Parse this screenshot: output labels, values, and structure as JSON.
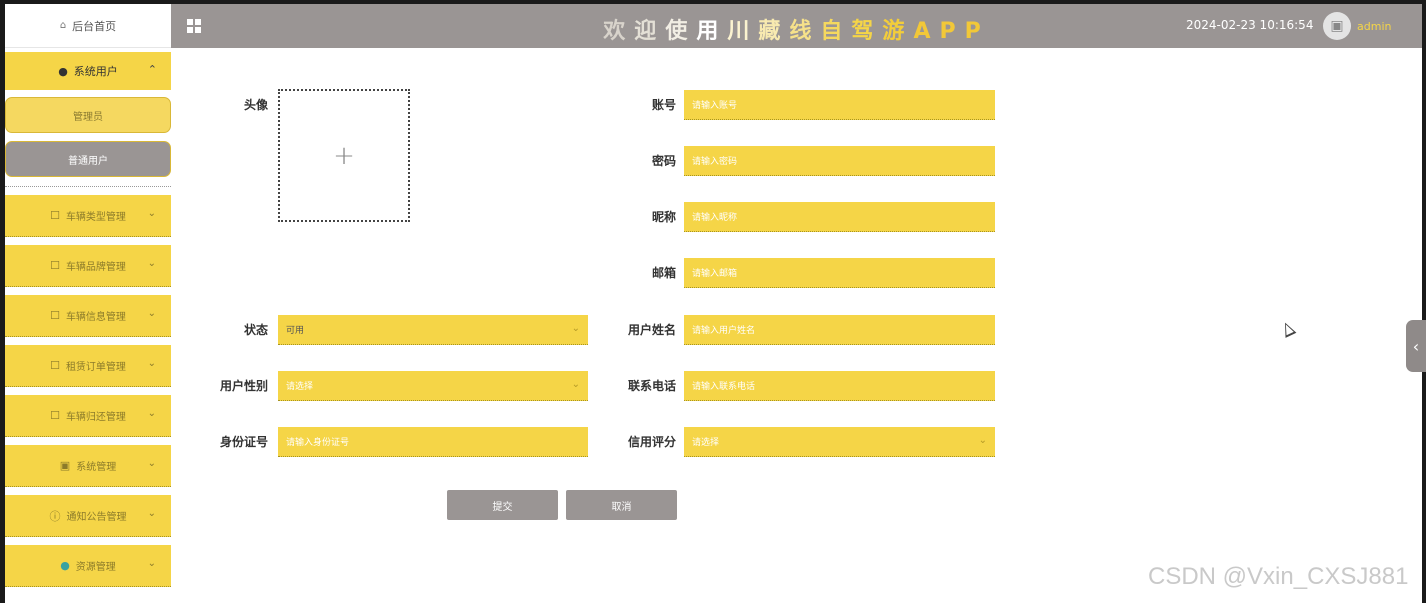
{
  "sidebar": {
    "home": {
      "label": "后台首页",
      "icon": "home-icon"
    },
    "open_menu": {
      "label": "系统用户",
      "icon": "user-icon"
    },
    "sub_items": [
      {
        "label": "管理员"
      },
      {
        "label": "普通用户"
      }
    ],
    "items": [
      {
        "label": "车辆类型管理",
        "icon": "edit-icon"
      },
      {
        "label": "车辆品牌管理",
        "icon": "edit-icon"
      },
      {
        "label": "车辆信息管理",
        "icon": "edit-icon"
      },
      {
        "label": "租赁订单管理",
        "icon": "edit-icon"
      },
      {
        "label": "车辆归还管理",
        "icon": "edit-icon"
      },
      {
        "label": "系统管理",
        "icon": "picture-icon"
      },
      {
        "label": "通知公告管理",
        "icon": "info-icon"
      },
      {
        "label": "资源管理",
        "icon": "location-icon"
      }
    ]
  },
  "header": {
    "title_chars": [
      {
        "ch": "欢",
        "color": "#d8d3cb"
      },
      {
        "ch": "迎",
        "color": "#e4e0d6"
      },
      {
        "ch": "使",
        "color": "#f2eee4"
      },
      {
        "ch": "用",
        "color": "#ffffff"
      },
      {
        "ch": "川",
        "color": "#fbf3d0"
      },
      {
        "ch": "藏",
        "color": "#f8eab0"
      },
      {
        "ch": "线",
        "color": "#f6e18a"
      },
      {
        "ch": "自",
        "color": "#f5d85e"
      },
      {
        "ch": "驾",
        "color": "#f5d547"
      },
      {
        "ch": "游",
        "color": "#f3cd3a"
      },
      {
        "ch": "A",
        "color": "#f2c838"
      },
      {
        "ch": "P",
        "color": "#f2c838"
      },
      {
        "ch": "P",
        "color": "#f2c838"
      }
    ],
    "datetime": "2024-02-23 10:16:54",
    "username": "admin"
  },
  "form": {
    "avatar_label": "头像",
    "upload_plus": "+",
    "account": {
      "label": "账号",
      "placeholder": "请输入账号"
    },
    "password": {
      "label": "密码",
      "placeholder": "请输入密码"
    },
    "nickname": {
      "label": "昵称",
      "placeholder": "请输入昵称"
    },
    "email": {
      "label": "邮箱",
      "placeholder": "请输入邮箱"
    },
    "status": {
      "label": "状态",
      "value": "可用"
    },
    "real_name": {
      "label": "用户姓名",
      "placeholder": "请输入用户姓名"
    },
    "gender": {
      "label": "用户性别",
      "placeholder": "请选择"
    },
    "phone": {
      "label": "联系电话",
      "placeholder": "请输入联系电话"
    },
    "id_card": {
      "label": "身份证号",
      "placeholder": "请输入身份证号"
    },
    "credit": {
      "label": "信用评分",
      "placeholder": "请选择"
    },
    "submit_label": "提交",
    "cancel_label": "取消"
  },
  "watermark": "CSDN @Vxin_CXSJ881",
  "colors": {
    "accent": "#f5d547",
    "header_bg": "#9a9594"
  }
}
